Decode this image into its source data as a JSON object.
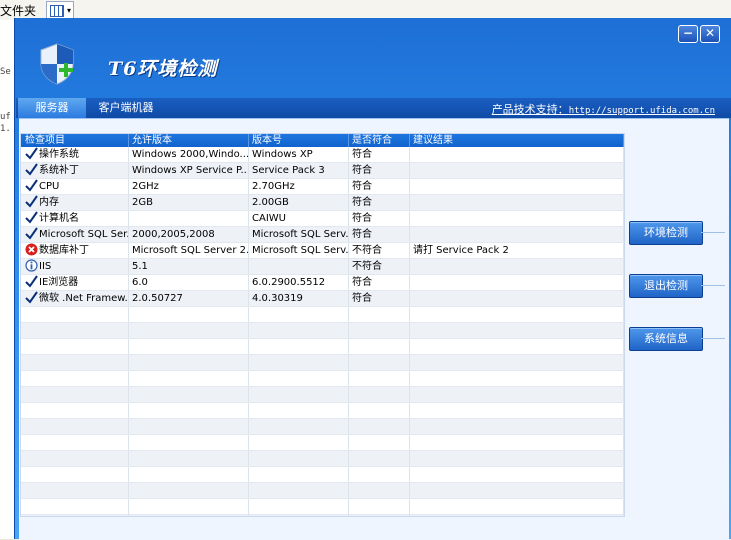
{
  "background": {
    "folder_label": "文件夹",
    "fragments": [
      "Se",
      "uf",
      "1."
    ]
  },
  "window": {
    "title": "T6环境检测",
    "minimize_symbol": "−",
    "close_symbol": "✕"
  },
  "tabs": [
    {
      "label": "服务器",
      "active": true
    },
    {
      "label": "客户端机器",
      "active": false
    }
  ],
  "support": {
    "label": "产品技术支持：",
    "url": "http://support.ufida.com.cn"
  },
  "table": {
    "headers": [
      "检查项目",
      "允许版本",
      "版本号",
      "是否符合",
      "建议结果"
    ],
    "rows": [
      {
        "status": "check",
        "item": "操作系统",
        "allowed": "Windows 2000,Windo...",
        "version": "Windows XP",
        "ok": "符合",
        "advice": ""
      },
      {
        "status": "check",
        "item": "系统补丁",
        "allowed": "Windows XP Service P...",
        "version": "Service Pack 3",
        "ok": "符合",
        "advice": ""
      },
      {
        "status": "check",
        "item": "CPU",
        "allowed": "2GHz",
        "version": "2.70GHz",
        "ok": "符合",
        "advice": ""
      },
      {
        "status": "check",
        "item": "内存",
        "allowed": "2GB",
        "version": "2.00GB",
        "ok": "符合",
        "advice": ""
      },
      {
        "status": "check",
        "item": "计算机名",
        "allowed": "",
        "version": "CAIWU",
        "ok": "符合",
        "advice": ""
      },
      {
        "status": "check",
        "item": "Microsoft SQL Ser...",
        "allowed": "2000,2005,2008",
        "version": "Microsoft SQL Serv...",
        "ok": "符合",
        "advice": ""
      },
      {
        "status": "error",
        "item": "数据库补丁",
        "allowed": "Microsoft SQL Server 2...",
        "version": "Microsoft SQL Serv...",
        "ok": "不符合",
        "advice": "请打 Service Pack 2"
      },
      {
        "status": "info",
        "item": "IIS",
        "allowed": "5.1",
        "version": "",
        "ok": "不符合",
        "advice": ""
      },
      {
        "status": "check",
        "item": "IE浏览器",
        "allowed": "6.0",
        "version": "6.0.2900.5512",
        "ok": "符合",
        "advice": ""
      },
      {
        "status": "check",
        "item": "微软 .Net Framew...",
        "allowed": "2.0.50727",
        "version": "4.0.30319",
        "ok": "符合",
        "advice": ""
      }
    ]
  },
  "buttons": {
    "check": "环境检测",
    "exit": "退出检测",
    "system_info": "系统信息"
  },
  "colors": {
    "accent": "#1f75e0",
    "check": "#0b2f7a",
    "error": "#d8201c",
    "info": "#2f5fb4"
  }
}
